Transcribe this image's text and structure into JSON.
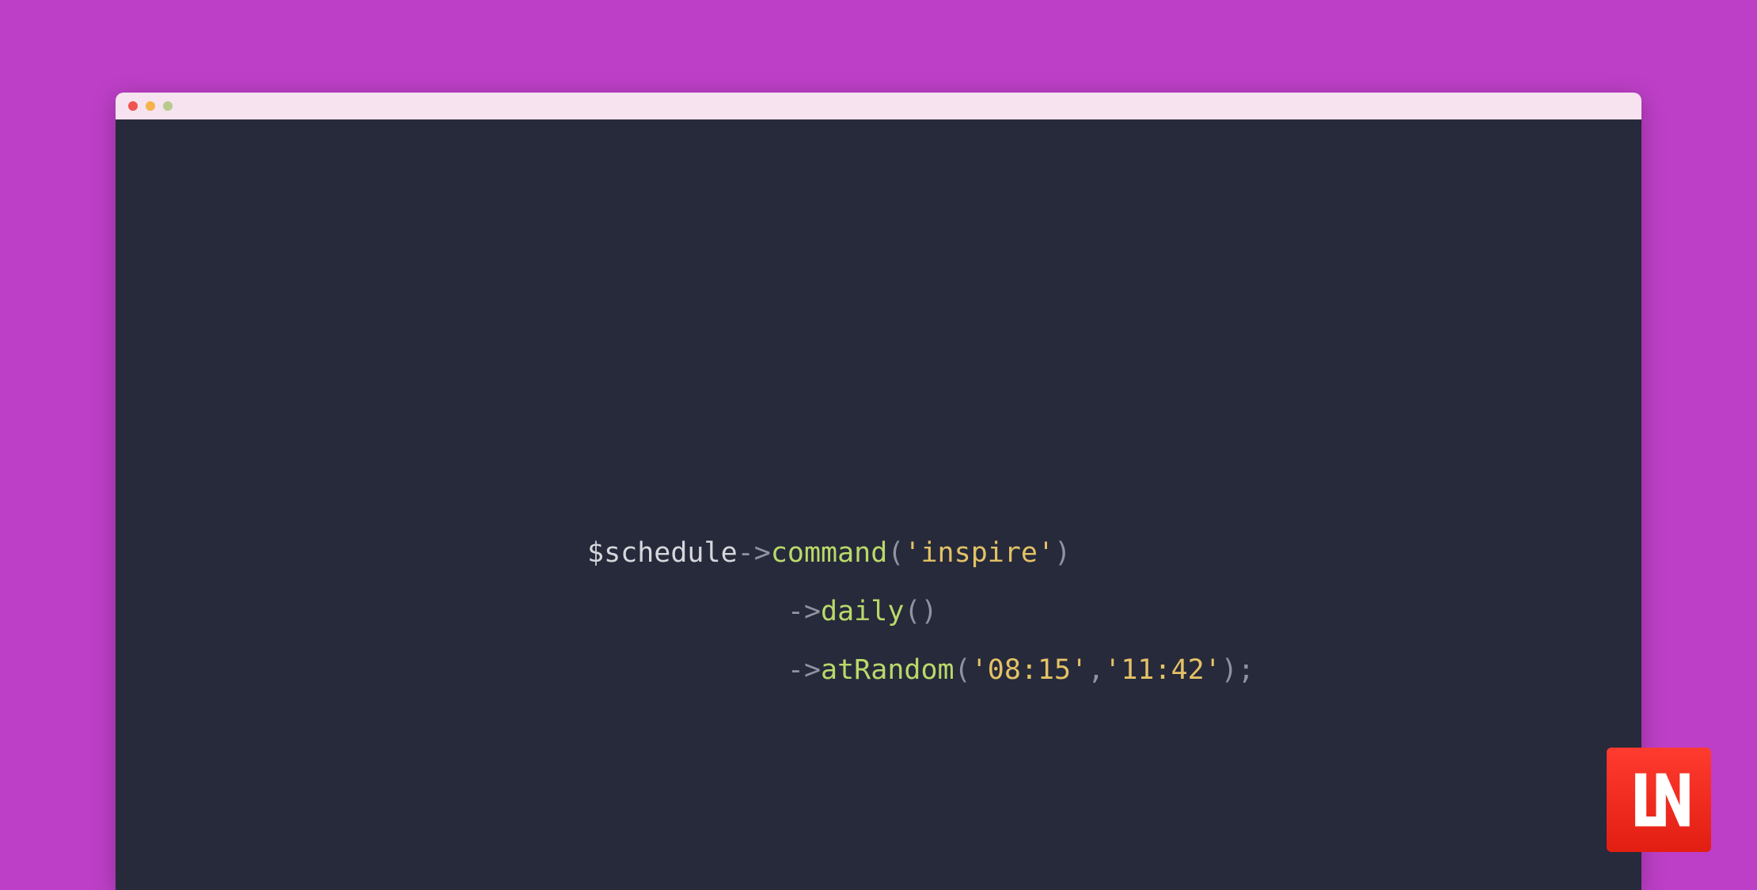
{
  "code": {
    "line1": {
      "var": "$schedule",
      "arrow": "->",
      "fn": "command",
      "open": "(",
      "q1": "'",
      "str": "inspire",
      "q2": "'",
      "close": ")"
    },
    "line2": {
      "indent": "            ",
      "arrow": "->",
      "fn": "daily",
      "open": "(",
      "close": ")"
    },
    "line3": {
      "indent": "            ",
      "arrow": "->",
      "fn": "atRandom",
      "open": "(",
      "q1": "'",
      "str1": "08:15",
      "q2": "'",
      "comma": ",",
      "q3": "'",
      "str2": "11:42",
      "q4": "'",
      "close": ")",
      "semi": ";"
    }
  },
  "logo_text": "LN",
  "colors": {
    "background": "#bd3fc7",
    "editor_bg": "#272a3a",
    "titlebar_bg": "#f6e3ef",
    "logo_bg": "#ff2d20"
  }
}
